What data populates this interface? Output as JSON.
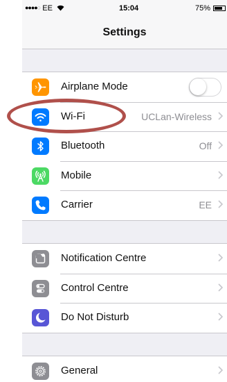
{
  "status_bar": {
    "signal_filled": "●●●●",
    "signal_empty": "○",
    "carrier": "EE",
    "time": "15:04",
    "battery_percent": "75%",
    "battery_level": 0.75
  },
  "nav": {
    "title": "Settings"
  },
  "groups": [
    {
      "rows": [
        {
          "label": "Airplane Mode",
          "icon": "airplane-icon",
          "icon_color": "#ff9500",
          "control": "toggle",
          "toggle_on": false
        },
        {
          "label": "Wi-Fi",
          "icon": "wifi-icon",
          "icon_color": "#007aff",
          "value": "UCLan-Wireless"
        },
        {
          "label": "Bluetooth",
          "icon": "bluetooth-icon",
          "icon_color": "#007aff",
          "value": "Off"
        },
        {
          "label": "Mobile",
          "icon": "antenna-icon",
          "icon_color": "#4cd964"
        },
        {
          "label": "Carrier",
          "icon": "phone-icon",
          "icon_color": "#007aff",
          "value": "EE"
        }
      ]
    },
    {
      "rows": [
        {
          "label": "Notification Centre",
          "icon": "notifications-icon",
          "icon_color": "#8e8e93"
        },
        {
          "label": "Control Centre",
          "icon": "control-centre-icon",
          "icon_color": "#8e8e93"
        },
        {
          "label": "Do Not Disturb",
          "icon": "moon-icon",
          "icon_color": "#5856d6"
        }
      ]
    },
    {
      "rows": [
        {
          "label": "General",
          "icon": "gear-icon",
          "icon_color": "#8e8e93"
        }
      ]
    }
  ],
  "annotation": {
    "shape": "ellipse",
    "color": "#b0504b",
    "target": "Wi-Fi"
  }
}
